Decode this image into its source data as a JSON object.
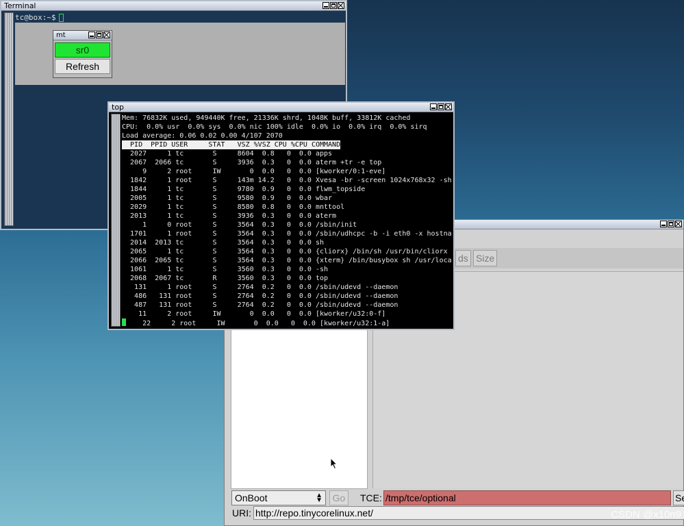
{
  "terminal": {
    "title": "Terminal",
    "prompt": "tc@box:~$"
  },
  "mnt": {
    "title": "mt",
    "device_button": "sr0",
    "refresh_button": "Refresh"
  },
  "apps_window": {
    "tabs": [
      "ds",
      "Size"
    ],
    "boot_select": "OnBoot",
    "go_button": "Go",
    "tce_label": "TCE:",
    "tce_value": "/tmp/tce/optional",
    "se_button": "Se",
    "uri_label": "URI:",
    "uri_value": "http://repo.tinycorelinux.net/"
  },
  "top": {
    "title": "top",
    "mem_line": "Mem: 76832K used, 949440K free, 21336K shrd, 1048K buff, 33812K cached",
    "cpu_line": "CPU:  0.0% usr  0.0% sys  0.0% nic 100% idle  0.0% io  0.0% irq  0.0% sirq",
    "load_line": "Load average: 0.06 0.02 0.00 4/107 2070",
    "header": "  PID  PPID USER     STAT   VSZ %VSZ CPU %CPU COMMAND",
    "processes": [
      "  2027     1 tc       S     8604  0.8   0  0.0 apps",
      "  2067  2066 tc       S     3936  0.3   0  0.0 aterm +tr -e top",
      "     9     2 root     IW       0  0.0   0  0.0 [kworker/0:1-eve]",
      "  1842     1 root     S     143m 14.2   0  0.0 Xvesa -br -screen 1024x768x32 -sha",
      "  1844     1 tc       S     9780  0.9   0  0.0 flwm_topside",
      "  2005     1 tc       S     9580  0.9   0  0.0 wbar",
      "  2029     1 tc       S     8580  0.8   0  0.0 mnttool",
      "  2013     1 tc       S     3936  0.3   0  0.0 aterm",
      "     1     0 root     S     3564  0.3   0  0.0 /sbin/init",
      "  1701     1 root     S     3564  0.3   0  0.0 /sbin/udhcpc -b -i eth0 -x hostnam",
      "  2014  2013 tc       S     3564  0.3   0  0.0 sh",
      "  2065     1 tc       S     3564  0.3   0  0.0 {cliorx} /bin/sh /usr/bin/cliorx t",
      "  2066  2065 tc       S     3564  0.3   0  0.0 {xterm} /bin/busybox sh /usr/local",
      "  1061     1 tc       S     3560  0.3   0  0.0 -sh",
      "  2068  2067 tc       R     3560  0.3   0  0.0 top",
      "   131     1 root     S     2764  0.2   0  0.0 /sbin/udevd --daemon",
      "   486   131 root     S     2764  0.2   0  0.0 /sbin/udevd --daemon",
      "   487   131 root     S     2764  0.2   0  0.0 /sbin/udevd --daemon",
      "    11     2 root     IW       0  0.0   0  0.0 [kworker/u32:0-f]"
    ],
    "last_row": "    22     2 root     IW       0  0.0   0  0.0 [kworker/u32:1-a]"
  },
  "watermark": "CSDN @x10n9"
}
